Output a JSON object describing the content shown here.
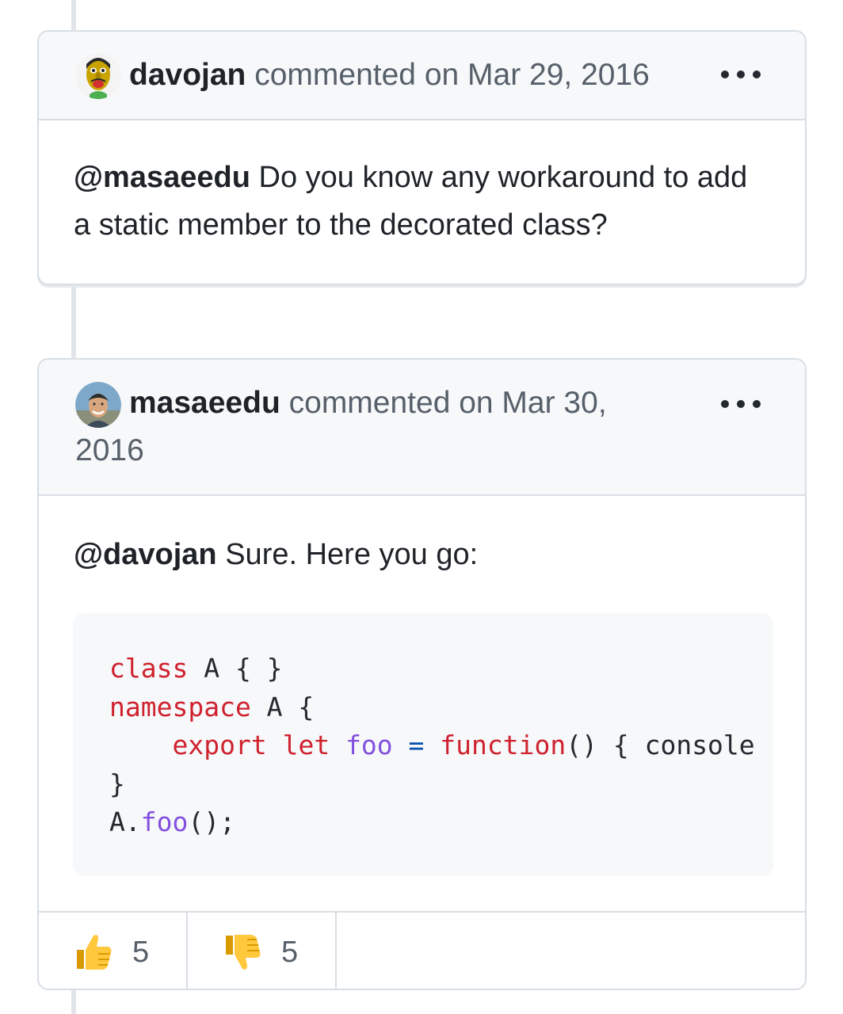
{
  "comments": [
    {
      "author": "davojan",
      "action": "commented on Mar 29, 2016",
      "avatar_icon": "cartoon-avatar-icon",
      "body": {
        "mention": "@masaeedu",
        "text": " Do you know any workaround to add a static member to the decorated class?"
      }
    },
    {
      "author": "masaeedu",
      "action": "commented on Mar 30, 2016",
      "avatar_icon": "photo-avatar-icon",
      "body": {
        "mention": "@davojan",
        "text": " Sure. Here you go:"
      },
      "code": [
        "class A { }",
        "namespace A {",
        "    export let foo = function() { console",
        "}",
        "A.foo();"
      ],
      "reactions": [
        {
          "icon": "thumbs-up-icon",
          "count": "5"
        },
        {
          "icon": "thumbs-down-icon",
          "count": "5"
        }
      ]
    }
  ],
  "colors": {
    "keyword": "#cf222e",
    "function": "#8250df",
    "operator": "#0550ae",
    "header_bg": "#f6f8fa",
    "border": "#d8dee4"
  }
}
